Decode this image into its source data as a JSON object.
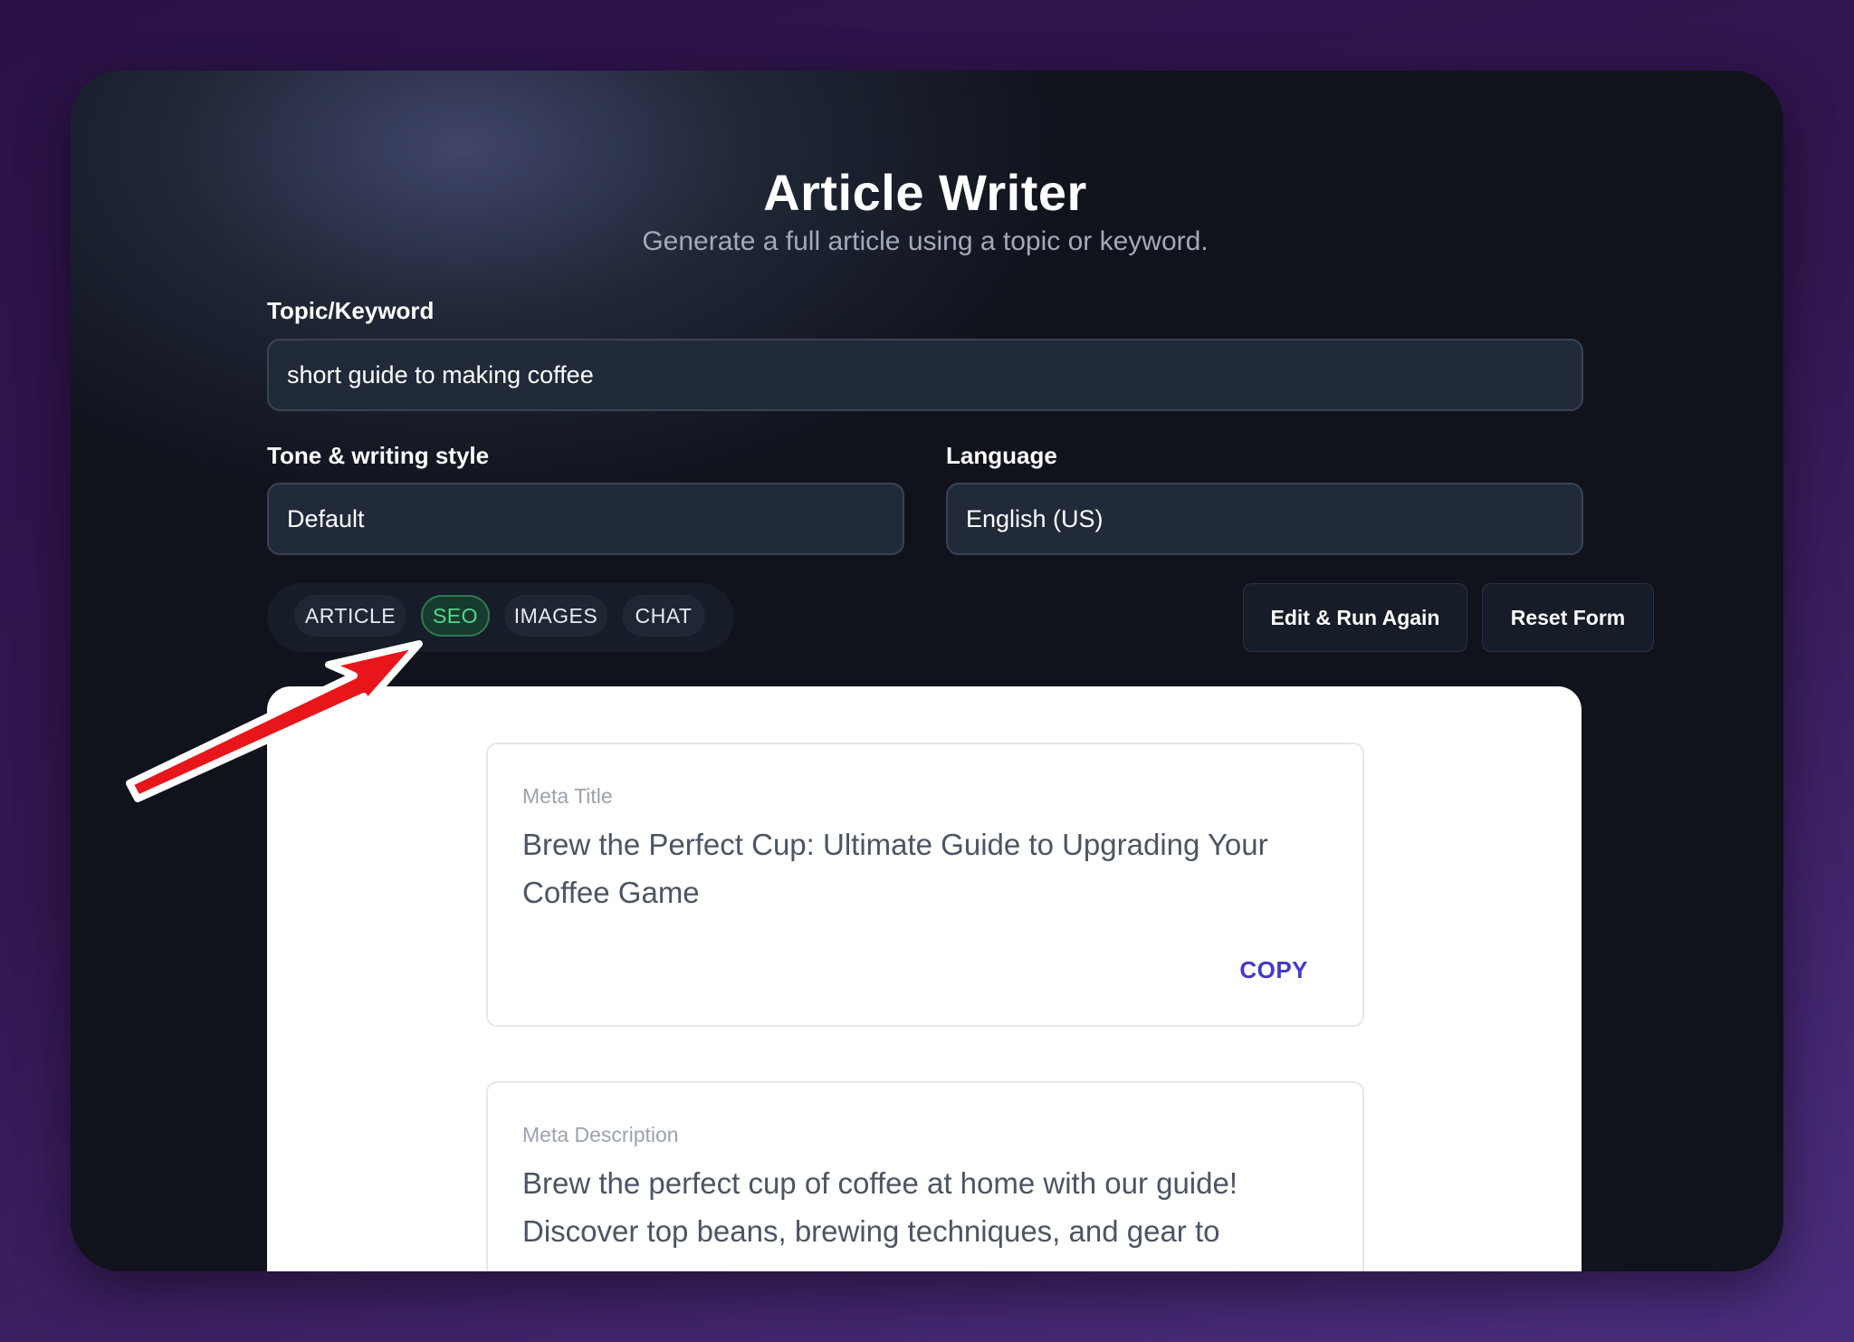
{
  "app": {
    "title": "Article Writer",
    "subtitle": "Generate a full article using a topic or keyword."
  },
  "form": {
    "topic_label": "Topic/Keyword",
    "topic_value": "short guide to making coffee",
    "tone_label": "Tone & writing style",
    "tone_value": "Default",
    "language_label": "Language",
    "language_value": "English (US)"
  },
  "tabs": [
    {
      "label": "ARTICLE",
      "active": false
    },
    {
      "label": "SEO",
      "active": true
    },
    {
      "label": "IMAGES",
      "active": false
    },
    {
      "label": "CHAT",
      "active": false
    }
  ],
  "actions": {
    "edit_run_label": "Edit & Run Again",
    "reset_label": "Reset Form"
  },
  "results": {
    "meta_title_label": "Meta Title",
    "meta_title_value": "Brew the Perfect Cup: Ultimate Guide to Upgrading Your Coffee Game",
    "copy_label": "COPY",
    "meta_description_label": "Meta Description",
    "meta_description_value": "Brew the perfect cup of coffee at home with our guide! Discover top beans, brewing techniques, and gear to"
  },
  "colors": {
    "accent_active_tab": "#4fd98a",
    "copy_link": "#4338ca",
    "annotation_arrow": "#e8151b"
  },
  "icons": {
    "annotation": "red-arrow-icon"
  }
}
